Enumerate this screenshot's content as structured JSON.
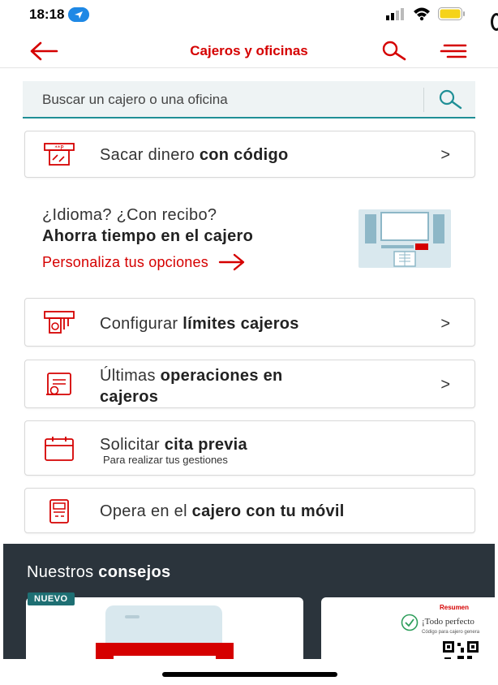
{
  "status_bar": {
    "time": "18:18",
    "icons": [
      "location-icon",
      "signal-icon",
      "wifi-icon",
      "battery-icon"
    ]
  },
  "app_bar": {
    "title": "Cajeros y oficinas",
    "icons": [
      "back-arrow-icon",
      "search-icon",
      "menu-icon"
    ]
  },
  "search": {
    "placeholder": "Buscar un cajero o una oficina"
  },
  "actions": [
    {
      "text": "Sacar dinero ",
      "bold": "con código",
      "icon": "atm-code-icon",
      "chevron": ">"
    },
    {
      "text": "Configurar ",
      "bold": "límites cajeros",
      "icon": "atm-limit-icon",
      "chevron": ">"
    },
    {
      "text": "Últimas ",
      "bold": "operaciones en",
      "line2": "cajeros",
      "icon": "receipt-icon",
      "chevron": ">"
    },
    {
      "text": "Solicitar ",
      "bold": "cita previa",
      "sub": "Para realizar tus gestiones",
      "icon": "calendar-icon"
    },
    {
      "text": "Opera en el ",
      "bold": "cajero con tu móvil",
      "icon": "mobile-atm-icon"
    }
  ],
  "promo": {
    "line1": "¿Idioma? ¿Con recibo?",
    "line2": "Ahorra tiempo en el cajero",
    "link": "Personaliza tus opciones"
  },
  "tips": {
    "title_regular": "Nuestros ",
    "title_bold": "consejos",
    "badge": "NUEVO",
    "card2_label": "Resumen",
    "card2_title": "¡Todo perfecto",
    "card2_sub": "Código para cajero genera"
  },
  "colors": {
    "brand_red": "#d50000",
    "accent_teal": "#1f8f96",
    "tips_bg": "#2b343c"
  }
}
